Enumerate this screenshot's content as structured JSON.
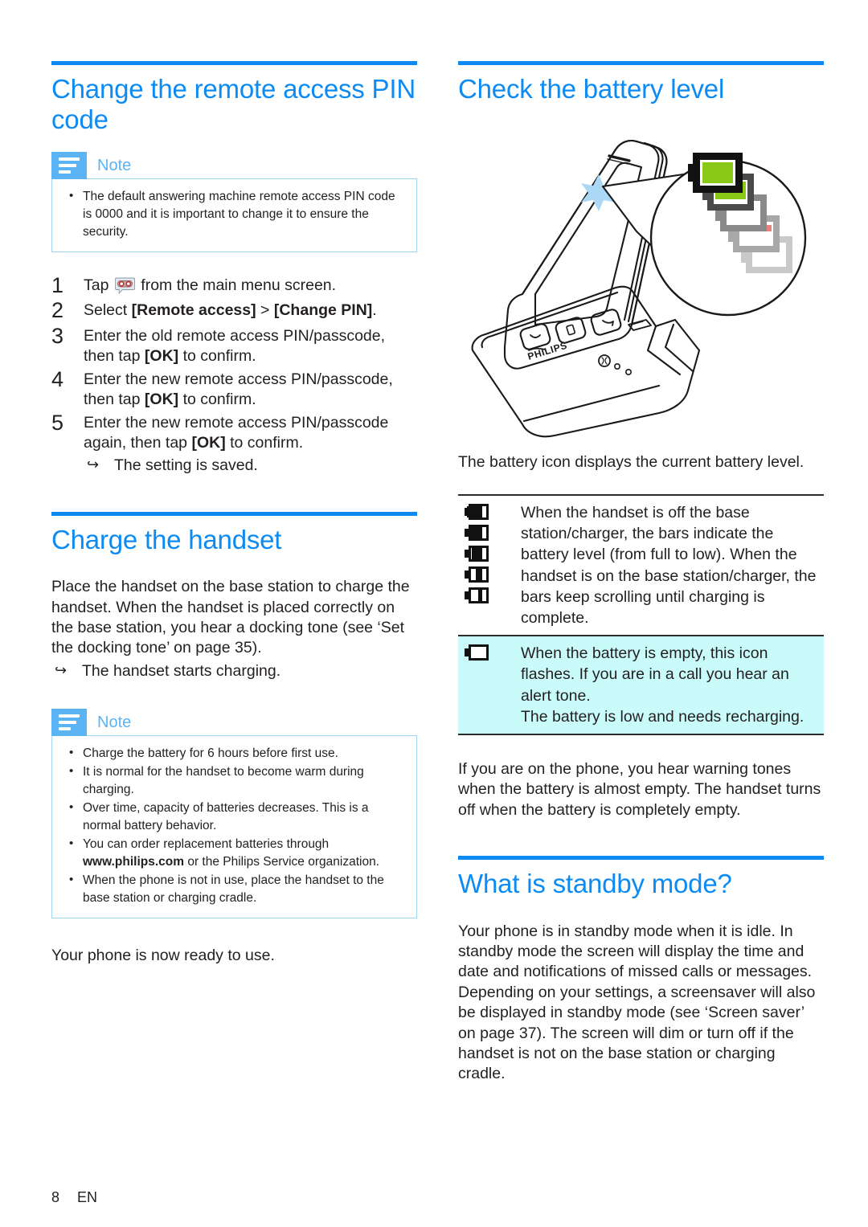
{
  "page": {
    "number": "8",
    "language": "EN"
  },
  "left_column": {
    "section1": {
      "title": "Change the remote access PIN code",
      "note": {
        "label": "Note",
        "icon": "note-lines-icon",
        "bullets": [
          "The default answering machine remote access PIN code is 0000 and it is important to change it to ensure the security."
        ]
      },
      "steps": [
        {
          "num": "1",
          "pre": "Tap ",
          "icon": "answering-machine-icon",
          "post": " from the main menu screen.",
          "text": "Tap  from the main menu screen."
        },
        {
          "num": "2",
          "text": "Select [Remote access] > [Change PIN]."
        },
        {
          "num": "3",
          "text": "Enter the old remote access PIN/passcode, then tap [OK] to confirm."
        },
        {
          "num": "4",
          "text": "Enter the new remote access PIN/passcode, then tap [OK] to confirm."
        },
        {
          "num": "5",
          "text": "Enter the new remote access PIN/passcode again, then tap [OK] to confirm."
        }
      ],
      "result": "The setting is saved."
    },
    "section2": {
      "title": "Charge the handset",
      "body": "Place the handset on the base station to charge the handset. When the handset is placed correctly on the base station, you hear a docking tone (see ‘Set the docking tone’ on page 35).",
      "result": "The handset starts charging.",
      "note": {
        "label": "Note",
        "icon": "note-lines-icon",
        "bullets": [
          "Charge the battery for 6 hours before first use.",
          "It is normal for the handset to become warm during charging.",
          "Over time, capacity of batteries decreases. This is a normal battery behavior.",
          "You can order replacement batteries through www.philips.com or the Philips Service organization.",
          "When the phone is not in use, place the handset to the base station or charging cradle."
        ],
        "bullet4_bold_a": "www.",
        "bullet4_bold_b": "philips.com"
      },
      "closing": "Your phone is now ready to use."
    }
  },
  "right_column": {
    "section1": {
      "title": "Check the battery level",
      "illustration": "handset-on-base-station-with-battery-callout",
      "intro": "The battery icon displays the current battery level.",
      "table": {
        "rows": [
          {
            "icons": [
              "battery-full-icon",
              "battery-high-icon",
              "battery-medium-icon",
              "battery-low-icon",
              "battery-very-low-icon"
            ],
            "text": "When the handset is off the base station/charger, the bars indicate the battery level (from full to low). When the handset is on the base station/charger, the bars keep scrolling until charging is complete.",
            "highlight": false
          },
          {
            "icons": [
              "battery-empty-icon"
            ],
            "text": "When the battery is empty, this icon flashes. If you are in a call you hear an alert tone.",
            "text2": "The battery is low and needs recharging.",
            "highlight": true
          }
        ]
      },
      "after_table": "If you are on the phone, you hear warning tones when the battery is almost empty. The handset turns off when the battery is completely empty."
    },
    "section2": {
      "title": "What is standby mode?",
      "body": "Your phone is in standby mode when it is idle. In standby mode the screen will display the time and date and notifications of missed calls or messages. Depending on your settings, a screensaver will also be displayed in standby mode (see ‘Screen saver’ on page 37). The screen will dim or turn off if the handset is not on the base station or charging cradle."
    }
  },
  "colors": {
    "heading_blue": "#0d8bf2",
    "note_icon_blue": "#5cb3f4",
    "note_border_blue": "#9ed4f7",
    "highlight_cyan": "#c9fbfb",
    "battery_green": "#8bc919",
    "text": "#231f20"
  }
}
